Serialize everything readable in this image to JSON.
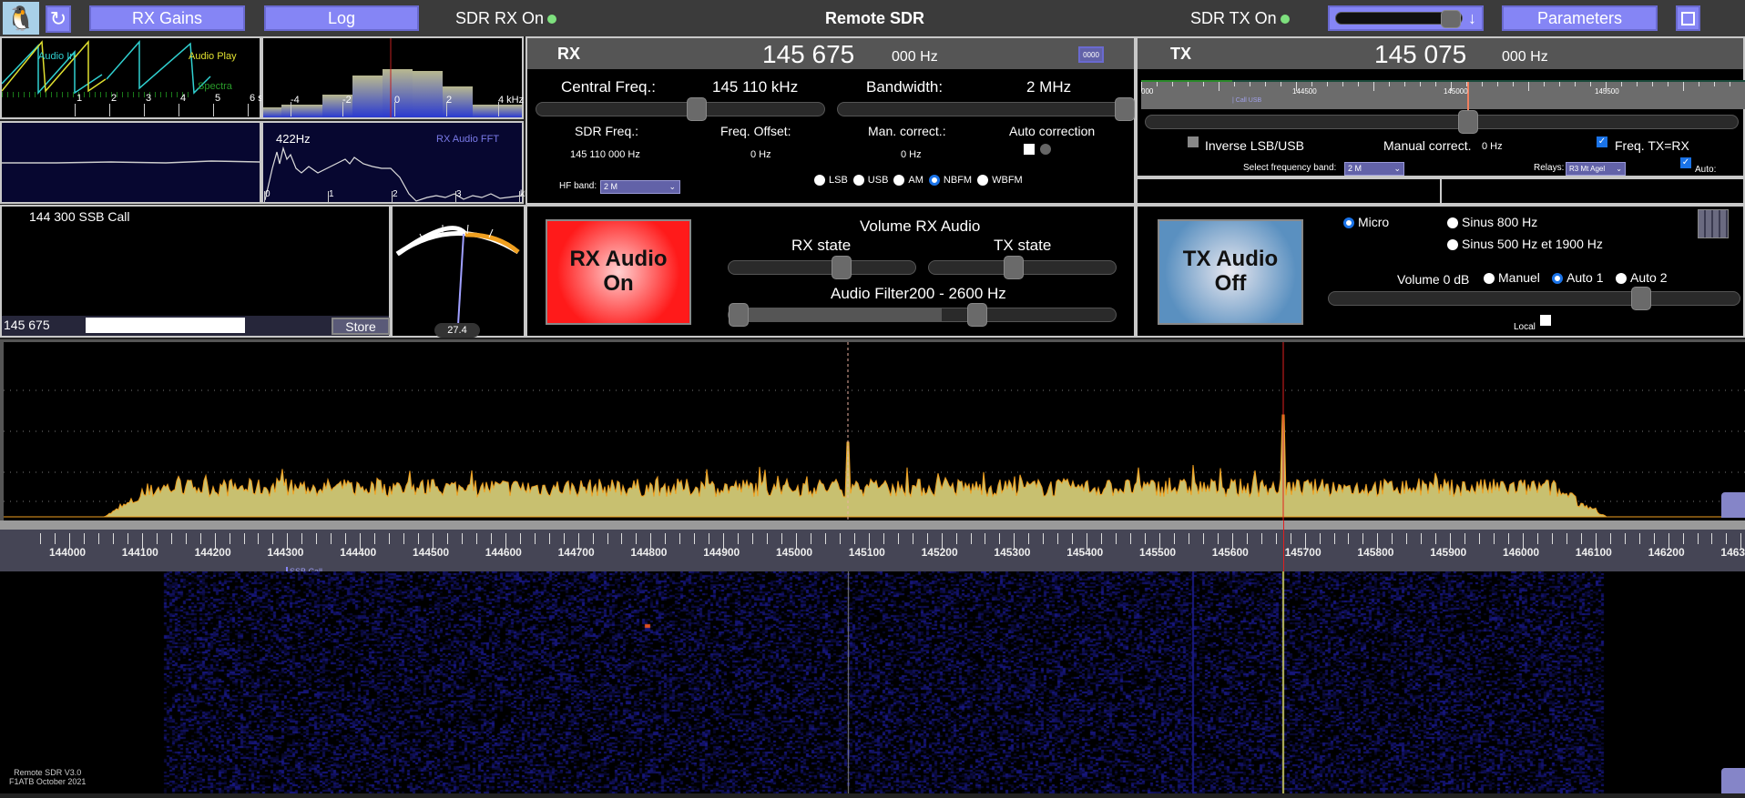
{
  "topbar": {
    "title": "Remote SDR",
    "rx_gains": "RX Gains",
    "log": "Log",
    "sdr_rx": "SDR RX On",
    "sdr_tx": "SDR TX On",
    "parameters": "Parameters",
    "slider_arrow": "↓",
    "led_color": "#7ee07e",
    "volume_level": 0.85
  },
  "audio_canvas": {
    "audio_in": "Audio In",
    "audio_play": "Audio Play",
    "spectra": "Spectra",
    "ticks": [
      "1",
      "2",
      "3",
      "4",
      "5",
      "6 s"
    ]
  },
  "if_canvas": {
    "ticks": [
      "-4",
      "-2",
      "0",
      "2",
      "4 kHz"
    ]
  },
  "fft_canvas": {
    "peak": "422Hz",
    "title": "RX Audio FFT",
    "ticks": [
      "0",
      "1",
      "2",
      "3",
      "kHz"
    ]
  },
  "rx": {
    "title": "RX",
    "freq_main": "145 675",
    "freq_sub": "000 Hz",
    "digits_button": "0000",
    "central_label": "Central Freq.:",
    "central_value": "145 110 kHz",
    "bandwidth_label": "Bandwidth:",
    "bandwidth_value": "2 MHz",
    "sdr_freq_label": "SDR Freq.:",
    "sdr_freq_value": "145 110 000 Hz",
    "offset_label": "Freq. Offset:",
    "offset_value": "0 Hz",
    "man_label": "Man. correct.:",
    "man_value": "0 Hz",
    "auto_label": "Auto correction",
    "hf_band_label": "HF band:",
    "hf_band_value": "2 M",
    "modes": [
      {
        "label": "LSB",
        "on": false
      },
      {
        "label": "USB",
        "on": false
      },
      {
        "label": "AM",
        "on": false
      },
      {
        "label": "NBFM",
        "on": true
      },
      {
        "label": "WBFM",
        "on": false
      }
    ]
  },
  "tx": {
    "title": "TX",
    "freq_main": "145 075",
    "freq_sub": "000 Hz",
    "scale_ticks": [
      "000",
      "144500",
      "145000",
      "145500",
      "146"
    ],
    "call_marker": "| Call USB",
    "inverse_label": "Inverse LSB/USB",
    "manual_label": "Manual correct.",
    "manual_value": "0 Hz",
    "freq_txrx_label": "Freq. TX=RX",
    "band_label": "Select frequency band:",
    "band_value": "2 M",
    "relays_label": "Relays:",
    "relays_value": "R3 Mt Agel",
    "auto_label": "Auto:"
  },
  "memory": {
    "entry": "144 300 SSB Call",
    "current": "145 675",
    "input_value": "",
    "store": "Store"
  },
  "smeter": {
    "value": "27.4"
  },
  "rx_audio": {
    "button_line1": "RX Audio",
    "button_line2": "On",
    "volume_label": "Volume RX Audio",
    "rx_state": "RX state",
    "tx_state": "TX state",
    "filter_label": "Audio Filter200 - 2600 Hz"
  },
  "tx_audio": {
    "button_line1": "TX Audio",
    "button_line2": "Off",
    "micro": "Micro",
    "sinus800": "Sinus 800 Hz",
    "sinus2": "Sinus 500 Hz et 1900 Hz",
    "volume_label": "Volume 0 dB",
    "manuel": "Manuel",
    "auto1": "Auto 1",
    "auto2": "Auto 2",
    "local": "Local",
    "source_selected": "Micro",
    "volume_selected": "Auto 1"
  },
  "scale": {
    "ticks": [
      "144000",
      "144100",
      "144200",
      "144300",
      "144400",
      "144500",
      "144600",
      "144700",
      "144800",
      "144900",
      "145000",
      "145100",
      "145200",
      "145300",
      "145400",
      "145500",
      "145600",
      "145700",
      "145800",
      "145900",
      "146000",
      "146100",
      "146200",
      "1463"
    ],
    "marker": "SSB Call"
  },
  "footer": {
    "line1": "Remote SDR V3.0",
    "line2": "F1ATB October 2021"
  },
  "colors": {
    "accent": "#8585f5",
    "spectrum_fill": "#c8c070",
    "spectrum_line": "#f0a020",
    "rx_line": "#e02020",
    "rx_button": "#ff2020",
    "tx_button": "#5a90c0"
  }
}
